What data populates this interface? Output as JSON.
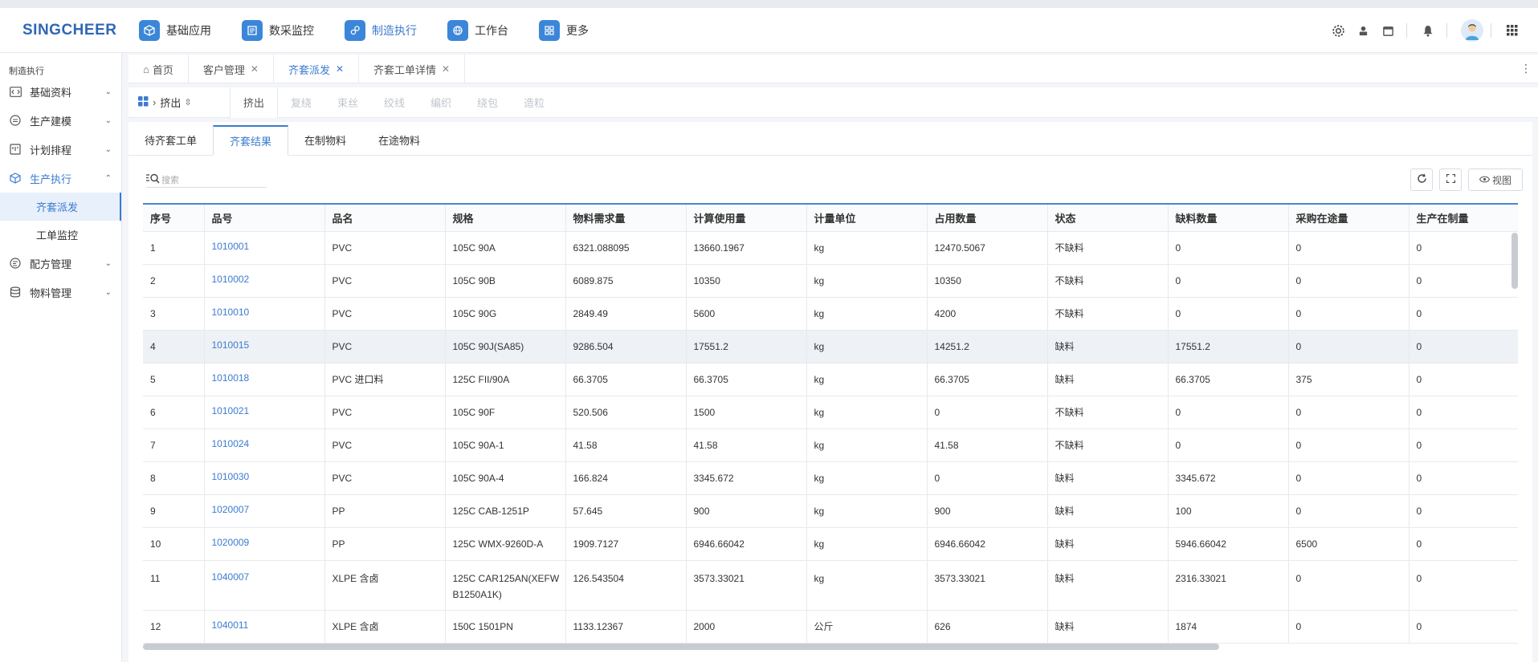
{
  "header": {
    "logo": "SINGCHEER",
    "nav": [
      {
        "label": "基础应用",
        "icon": "cube-icon"
      },
      {
        "label": "数采监控",
        "icon": "monitor-icon"
      },
      {
        "label": "制造执行",
        "icon": "gear-link-icon"
      },
      {
        "label": "工作台",
        "icon": "globe-icon"
      },
      {
        "label": "更多",
        "icon": "apps-icon"
      }
    ]
  },
  "sidebar": {
    "title": "制造执行",
    "items": [
      {
        "label": "基础资料",
        "icon": "code-box-icon"
      },
      {
        "label": "生产建模",
        "icon": "model-icon"
      },
      {
        "label": "计划排程",
        "icon": "schedule-icon"
      },
      {
        "label": "生产执行",
        "icon": "cube-outline-icon"
      },
      {
        "label": "配方管理",
        "icon": "formula-icon"
      },
      {
        "label": "物料管理",
        "icon": "database-icon"
      }
    ],
    "subitems": [
      "齐套派发",
      "工单监控"
    ]
  },
  "page_tabs": [
    {
      "label": "首页"
    },
    {
      "label": "客户管理"
    },
    {
      "label": "齐套派发"
    },
    {
      "label": "齐套工单详情"
    }
  ],
  "process": {
    "selector": "挤出",
    "tabs": [
      "挤出",
      "复绕",
      "束丝",
      "绞线",
      "编织",
      "绕包",
      "造粒"
    ]
  },
  "sub_tabs": [
    "待齐套工单",
    "齐套结果",
    "在制物料",
    "在途物料"
  ],
  "search": {
    "placeholder": "搜索"
  },
  "toolbar": {
    "view_label": "视图"
  },
  "table": {
    "columns": [
      "序号",
      "品号",
      "品名",
      "规格",
      "物料需求量",
      "计算使用量",
      "计量单位",
      "占用数量",
      "状态",
      "缺料数量",
      "采购在途量",
      "生产在制量"
    ],
    "rows": [
      [
        "1",
        "1010001",
        "PVC",
        "105C 90A",
        "6321.088095",
        "13660.1967",
        "kg",
        "12470.5067",
        "不缺料",
        "0",
        "0",
        "0"
      ],
      [
        "2",
        "1010002",
        "PVC",
        "105C 90B",
        "6089.875",
        "10350",
        "kg",
        "10350",
        "不缺料",
        "0",
        "0",
        "0"
      ],
      [
        "3",
        "1010010",
        "PVC",
        "105C 90G",
        "2849.49",
        "5600",
        "kg",
        "4200",
        "不缺料",
        "0",
        "0",
        "0"
      ],
      [
        "4",
        "1010015",
        "PVC",
        "105C 90J(SA85)",
        "9286.504",
        "17551.2",
        "kg",
        "14251.2",
        "缺料",
        "17551.2",
        "0",
        "0"
      ],
      [
        "5",
        "1010018",
        "PVC 进口料",
        "125C FII/90A",
        "66.3705",
        "66.3705",
        "kg",
        "66.3705",
        "缺料",
        "66.3705",
        "375",
        "0"
      ],
      [
        "6",
        "1010021",
        "PVC",
        "105C 90F",
        "520.506",
        "1500",
        "kg",
        "0",
        "不缺料",
        "0",
        "0",
        "0"
      ],
      [
        "7",
        "1010024",
        "PVC",
        "105C 90A-1",
        "41.58",
        "41.58",
        "kg",
        "41.58",
        "不缺料",
        "0",
        "0",
        "0"
      ],
      [
        "8",
        "1010030",
        "PVC",
        "105C 90A-4",
        "166.824",
        "3345.672",
        "kg",
        "0",
        "缺料",
        "3345.672",
        "0",
        "0"
      ],
      [
        "9",
        "1020007",
        "PP",
        "125C CAB-1251P",
        "57.645",
        "900",
        "kg",
        "900",
        "缺料",
        "100",
        "0",
        "0"
      ],
      [
        "10",
        "1020009",
        "PP",
        "125C WMX-9260D-A",
        "1909.7127",
        "6946.66042",
        "kg",
        "6946.66042",
        "缺料",
        "5946.66042",
        "6500",
        "0"
      ],
      [
        "11",
        "1040007",
        "XLPE 含卤",
        "125C CAR125AN(XEFW B1250A1K)",
        "126.543504",
        "3573.33021",
        "kg",
        "3573.33021",
        "缺料",
        "2316.33021",
        "0",
        "0"
      ],
      [
        "12",
        "1040011",
        "XLPE 含卤",
        "150C 1501PN",
        "1133.12367",
        "2000",
        "公斤",
        "626",
        "缺料",
        "1874",
        "0",
        "0"
      ]
    ]
  }
}
